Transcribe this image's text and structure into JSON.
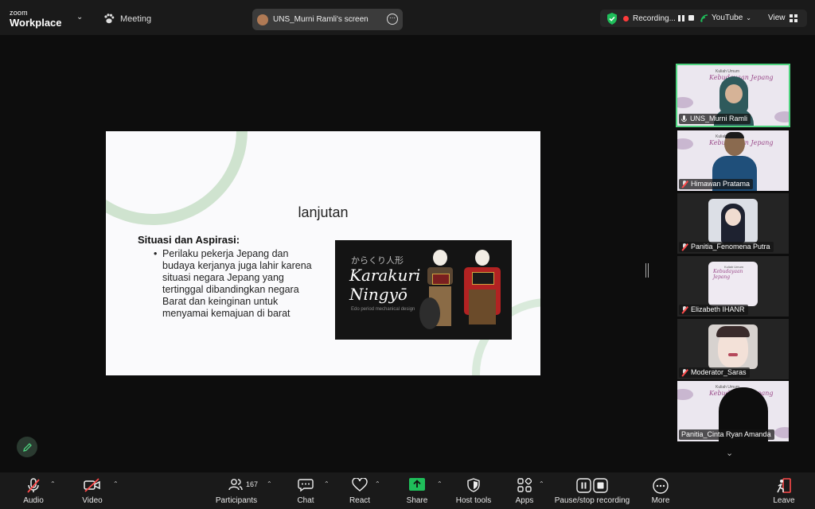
{
  "app": {
    "logo_line1": "zoom",
    "logo_line2": "Workplace",
    "meeting_label": "Meeting"
  },
  "screen_share": {
    "label": "UNS_Murni Ramli's screen"
  },
  "recording": {
    "label": "Recording...",
    "stream_label": "YouTube",
    "view_label": "View"
  },
  "slide": {
    "title": "lanjutan",
    "heading": "Situasi dan Aspirasi:",
    "bullet": "Perilaku pekerja Jepang dan budaya kerjanya juga lahir karena situasi negara Jepang yang tertinggal dibandingkan negara Barat dan keinginan untuk menyamai kemajuan di barat",
    "image_jp": "からくり人形",
    "image_title1": "Karakuri",
    "image_title2": "Ningyō",
    "image_caption": "Edo period mechanical design"
  },
  "tile_banner": {
    "line1": "Kuliah Umum",
    "line2": "Kebudayaan Jepang"
  },
  "participants": [
    {
      "name": "UNS_Murni Ramli",
      "muted": false,
      "active": true
    },
    {
      "name": "Himawan Pratama",
      "muted": true
    },
    {
      "name": "Panitia_Fenomena Putra",
      "muted": true
    },
    {
      "name": "Elizabeth IHANR",
      "muted": true
    },
    {
      "name": "Moderator_Saras",
      "muted": true
    },
    {
      "name": "Panitia_Cinta Ryan Amanda",
      "muted": false
    }
  ],
  "toolbar": {
    "audio": "Audio",
    "video": "Video",
    "participants": "Participants",
    "participants_count": "167",
    "chat": "Chat",
    "react": "React",
    "share": "Share",
    "host_tools": "Host tools",
    "apps": "Apps",
    "record": "Pause/stop recording",
    "more": "More",
    "leave": "Leave"
  },
  "colors": {
    "accent_green": "#4fd480",
    "share_green": "#1fbe5a",
    "record_red": "#ff3b3b",
    "leave_red": "#ff4a4a"
  }
}
